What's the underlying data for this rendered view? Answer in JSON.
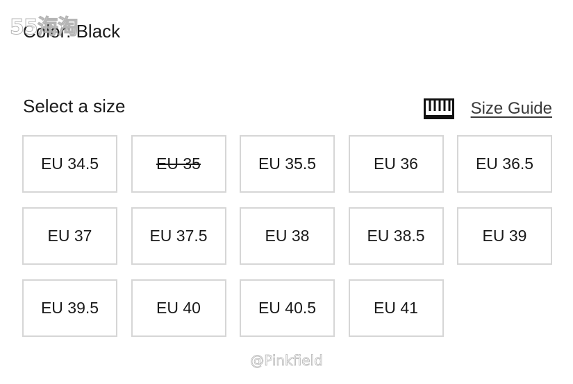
{
  "watermarks": {
    "top": "55海淘",
    "bottom": "@Pinkfield"
  },
  "product": {
    "color_line": "Color: Black"
  },
  "size_section": {
    "title": "Select a size",
    "guide_icon": "ruler-icon",
    "guide_label": "Size Guide",
    "sizes": [
      {
        "label": "EU 34.5",
        "available": true
      },
      {
        "label": "EU 35",
        "available": false
      },
      {
        "label": "EU 35.5",
        "available": true
      },
      {
        "label": "EU 36",
        "available": true
      },
      {
        "label": "EU 36.5",
        "available": true
      },
      {
        "label": "EU 37",
        "available": true
      },
      {
        "label": "EU 37.5",
        "available": true
      },
      {
        "label": "EU 38",
        "available": true
      },
      {
        "label": "EU 38.5",
        "available": true
      },
      {
        "label": "EU 39",
        "available": true
      },
      {
        "label": "EU 39.5",
        "available": true
      },
      {
        "label": "EU 40",
        "available": true
      },
      {
        "label": "EU 40.5",
        "available": true
      },
      {
        "label": "EU 41",
        "available": true
      }
    ]
  },
  "colors": {
    "border": "#d6d6d6",
    "text": "#1a1a1a",
    "background": "#ffffff"
  }
}
